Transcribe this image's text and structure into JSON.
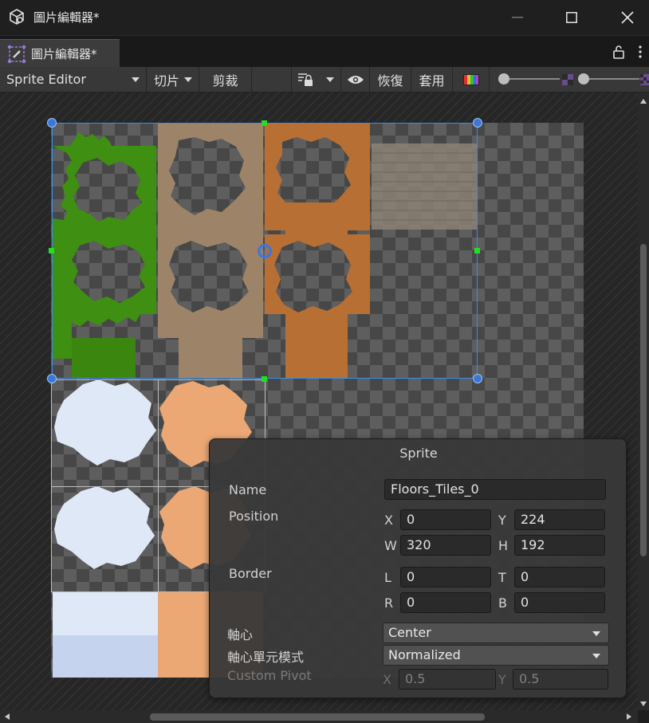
{
  "window": {
    "title": "圖片編輯器*",
    "tab_label": "圖片編輯器*"
  },
  "toolbar": {
    "editor_mode": "Sprite Editor",
    "slice_label": "切片",
    "trim_label": "剪裁",
    "revert_label": "恢復",
    "apply_label": "套用"
  },
  "sprite_panel": {
    "title": "Sprite",
    "name_label": "Name",
    "name_value": "Floors_Tiles_0",
    "position_label": "Position",
    "x_label": "X",
    "x_value": "0",
    "y_label": "Y",
    "y_value": "224",
    "w_label": "W",
    "w_value": "320",
    "h_label": "H",
    "h_value": "192",
    "border_label": "Border",
    "l_label": "L",
    "l_value": "0",
    "t_label": "T",
    "t_value": "0",
    "r_label": "R",
    "r_value": "0",
    "b_label": "B",
    "b_value": "0",
    "pivot_label": "軸心",
    "pivot_value": "Center",
    "pivot_unit_label": "軸心單元模式",
    "pivot_unit_value": "Normalized",
    "custom_pivot_label": "Custom Pivot",
    "custom_x_label": "X",
    "custom_x_value": "0.5",
    "custom_y_label": "Y",
    "custom_y_value": "0.5"
  },
  "colors": {
    "selection": "#3b8ee8",
    "handle_green": "#20e020",
    "grass": "#3f8f12",
    "dirt": "#9d8468",
    "clay": "#b86f33",
    "ice": "#dfe8f7",
    "sand": "#eba774"
  }
}
